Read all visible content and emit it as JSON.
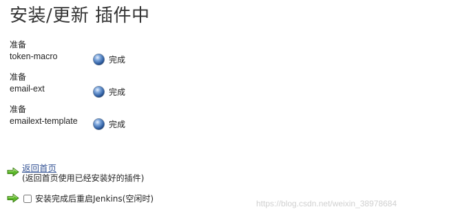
{
  "page_title": "安装/更新 插件中",
  "plugins": [
    {
      "prepare_label": "准备",
      "name": "token-macro",
      "status": "完成",
      "status_icon": "blue-ball-icon"
    },
    {
      "prepare_label": "准备",
      "name": "email-ext",
      "status": "完成",
      "status_icon": "blue-ball-icon"
    },
    {
      "prepare_label": "准备",
      "name": "emailext-template",
      "status": "完成",
      "status_icon": "blue-ball-icon"
    }
  ],
  "actions": {
    "back_link_label": "返回首页",
    "back_link_desc": "(返回首页使用已经安装好的插件)",
    "restart_label": "安装完成后重启Jenkins(空闲时)",
    "restart_checked": false,
    "arrow_icon": "green-arrow-icon"
  },
  "watermark": "https://blog.csdn.net/weixin_38978684",
  "colors": {
    "link": "#3b5998",
    "status_ball": "#4a78b8",
    "arrow": "#4caf1c"
  }
}
